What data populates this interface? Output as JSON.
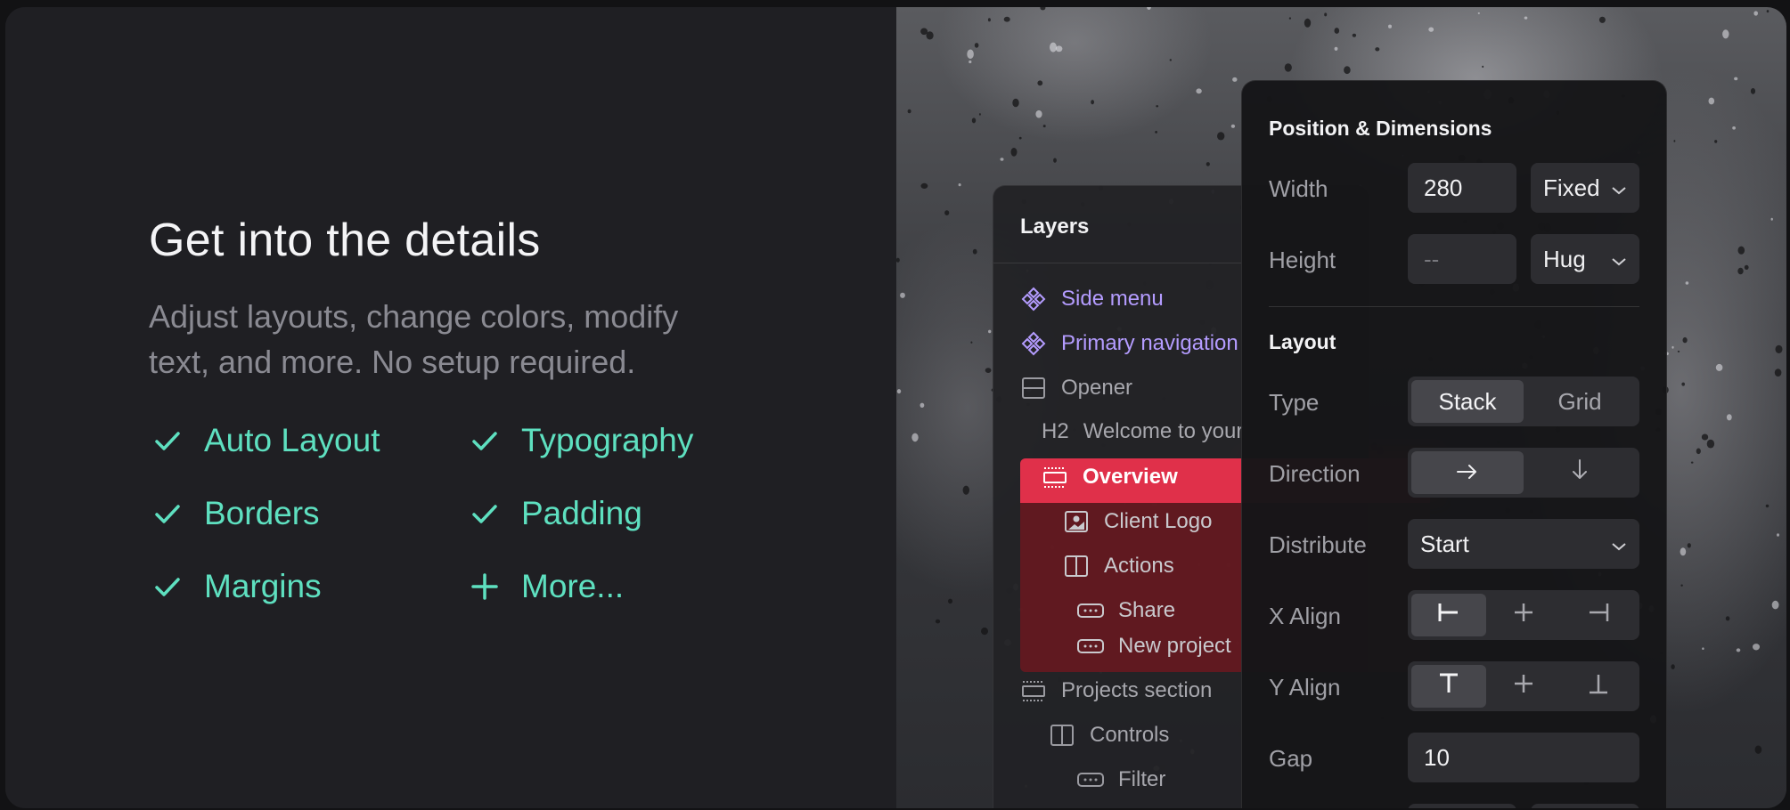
{
  "hero": {
    "title": "Get into the details",
    "subtitle": "Adjust layouts, change colors, modify text, and more. No setup required."
  },
  "features": [
    {
      "label": "Auto Layout",
      "icon": "check-icon"
    },
    {
      "label": "Typography",
      "icon": "check-icon"
    },
    {
      "label": "Borders",
      "icon": "check-icon"
    },
    {
      "label": "Padding",
      "icon": "check-icon"
    },
    {
      "label": "Margins",
      "icon": "check-icon"
    },
    {
      "label": "More...",
      "icon": "plus-icon"
    }
  ],
  "colors": {
    "accent": "#5ee0c0",
    "component": "#b49cff",
    "selection": "#e0304a"
  },
  "layers": {
    "title": "Layers",
    "items": [
      {
        "label": "Side menu",
        "icon": "component-icon"
      },
      {
        "label": "Primary navigation",
        "icon": "component-icon"
      },
      {
        "label": "Opener",
        "icon": "frame-icon"
      },
      {
        "tag": "H2",
        "label": "Welcome to your",
        "icon": "heading-icon"
      },
      {
        "label": "Overview",
        "icon": "section-icon"
      },
      {
        "label": "Client Logo",
        "icon": "image-icon"
      },
      {
        "label": "Actions",
        "icon": "columns-icon"
      },
      {
        "label": "Share",
        "icon": "button-icon"
      },
      {
        "label": "New project",
        "icon": "button-icon"
      },
      {
        "label": "Projects section",
        "icon": "section-icon"
      },
      {
        "label": "Controls",
        "icon": "columns-icon"
      },
      {
        "label": "Filter",
        "icon": "button-icon"
      }
    ]
  },
  "properties": {
    "position_title": "Position & Dimensions",
    "width_label": "Width",
    "width_value": "280",
    "width_mode": "Fixed",
    "height_label": "Height",
    "height_value": "--",
    "height_mode": "Hug",
    "layout_title": "Layout",
    "type_label": "Type",
    "type_options": [
      "Stack",
      "Grid"
    ],
    "type_selected": "Stack",
    "direction_label": "Direction",
    "direction_options": [
      "→",
      "↓"
    ],
    "distribute_label": "Distribute",
    "distribute_value": "Start",
    "xalign_label": "X Align",
    "yalign_label": "Y Align",
    "gap_label": "Gap",
    "gap_value": "10"
  }
}
